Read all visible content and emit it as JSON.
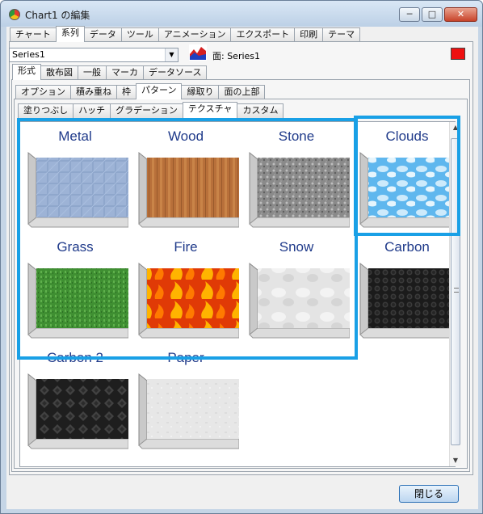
{
  "window": {
    "title": "Chart1 の編集",
    "controls": {
      "minimize": "─",
      "maximize": "□",
      "close": "✕"
    }
  },
  "main_tabs": [
    "チャート",
    "系列",
    "データ",
    "ツール",
    "アニメーション",
    "エクスポート",
    "印刷",
    "テーマ"
  ],
  "series": {
    "selected": "Series1",
    "label": "面: Series1",
    "color": "#ee1111"
  },
  "format_tabs": [
    "形式",
    "散布図",
    "一般",
    "マーカ",
    "データソース"
  ],
  "sub_tabs": [
    "オプション",
    "積み重ね",
    "枠",
    "パターン",
    "縁取り",
    "面の上部"
  ],
  "fill_tabs": [
    "塗りつぶし",
    "ハッチ",
    "グラデーション",
    "テクスチャ",
    "カスタム"
  ],
  "textures": [
    "Metal",
    "Wood",
    "Stone",
    "Clouds",
    "Grass",
    "Fire",
    "Snow",
    "Carbon",
    "Carbon 2",
    "Paper"
  ],
  "buttons": {
    "close": "閉じる"
  },
  "highlight_color": "#19a0e6"
}
